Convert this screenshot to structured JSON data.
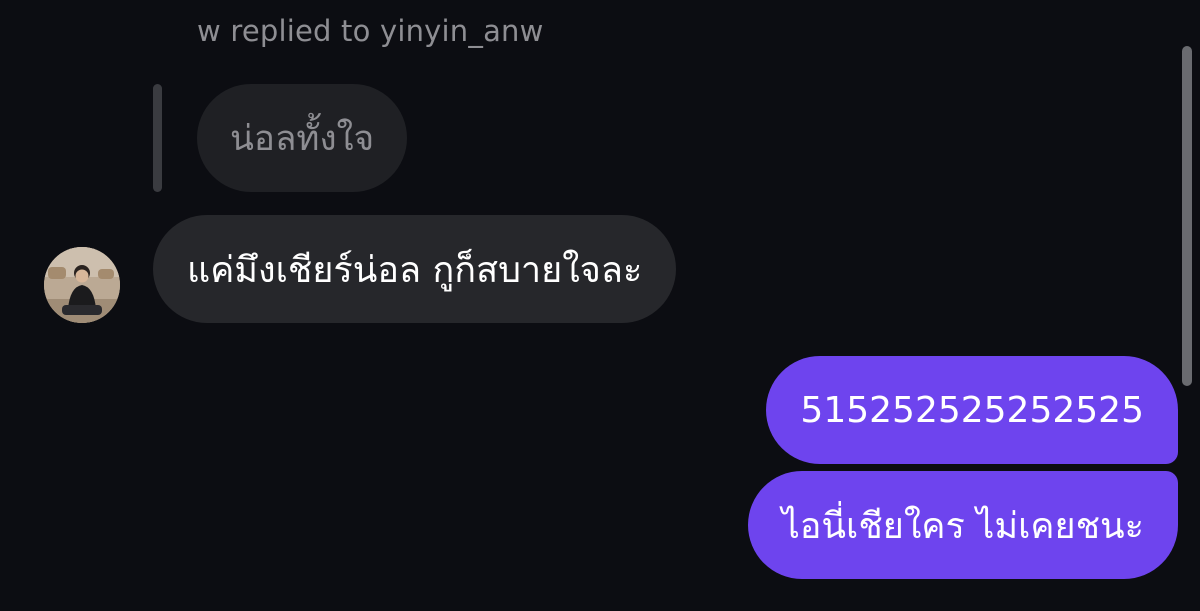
{
  "reply": {
    "header": "w replied to yinyin_anw",
    "quoted_text": "น่อลทั้งใจ"
  },
  "incoming": {
    "text": "แค่มึงเชียร์น่อล กูก็สบายใจละ"
  },
  "outgoing": [
    {
      "text": "515252525252525"
    },
    {
      "text": "ไอนี่เชียใคร ไม่เคยชนะ"
    }
  ],
  "colors": {
    "background": "#0c0d12",
    "incoming_bubble": "#26272b",
    "quoted_bubble": "#1f2024",
    "outgoing_bubble": "#6e44ee",
    "secondary_text": "#8e8e93"
  }
}
